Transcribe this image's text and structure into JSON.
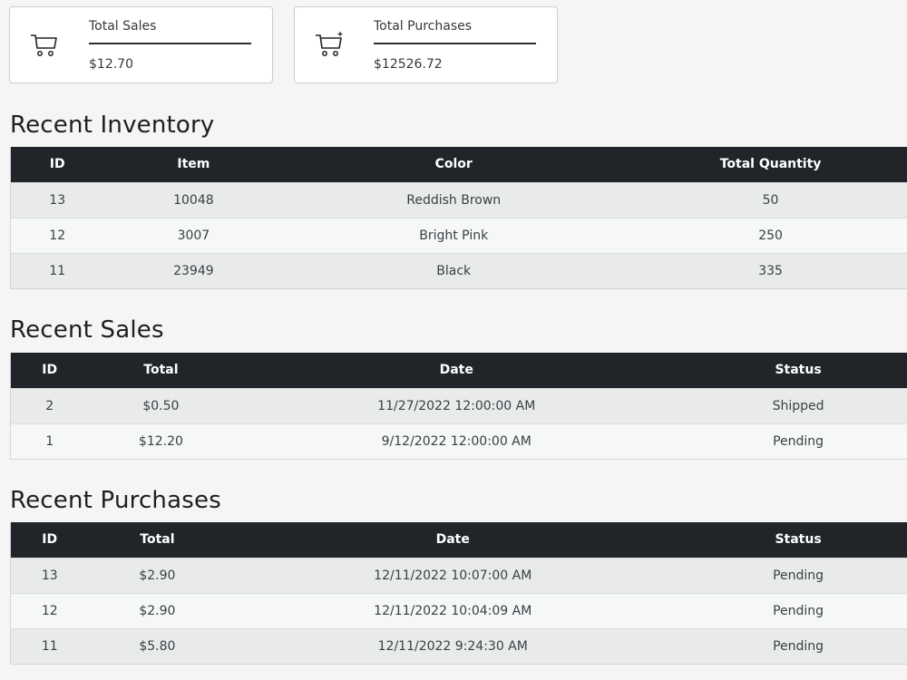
{
  "cards": [
    {
      "label": "Total Sales",
      "value": "$12.70",
      "icon": "cart-icon"
    },
    {
      "label": "Total Purchases",
      "value": "$12526.72",
      "icon": "cart-plus-icon"
    }
  ],
  "inventory": {
    "title": "Recent Inventory",
    "headers": [
      "ID",
      "Item",
      "Color",
      "Total Quantity"
    ],
    "rows": [
      [
        "13",
        "10048",
        "Reddish Brown",
        "50"
      ],
      [
        "12",
        "3007",
        "Bright Pink",
        "250"
      ],
      [
        "11",
        "23949",
        "Black",
        "335"
      ]
    ]
  },
  "sales": {
    "title": "Recent Sales",
    "headers": [
      "ID",
      "Total",
      "Date",
      "Status"
    ],
    "rows": [
      [
        "2",
        "$0.50",
        "11/27/2022 12:00:00 AM",
        "Shipped"
      ],
      [
        "1",
        "$12.20",
        "9/12/2022 12:00:00 AM",
        "Pending"
      ]
    ]
  },
  "purchases": {
    "title": "Recent Purchases",
    "headers": [
      "ID",
      "Total",
      "Date",
      "Status"
    ],
    "rows": [
      [
        "13",
        "$2.90",
        "12/11/2022 10:07:00 AM",
        "Pending"
      ],
      [
        "12",
        "$2.90",
        "12/11/2022 10:04:09 AM",
        "Pending"
      ],
      [
        "11",
        "$5.80",
        "12/11/2022 9:24:30 AM",
        "Pending"
      ]
    ]
  }
}
